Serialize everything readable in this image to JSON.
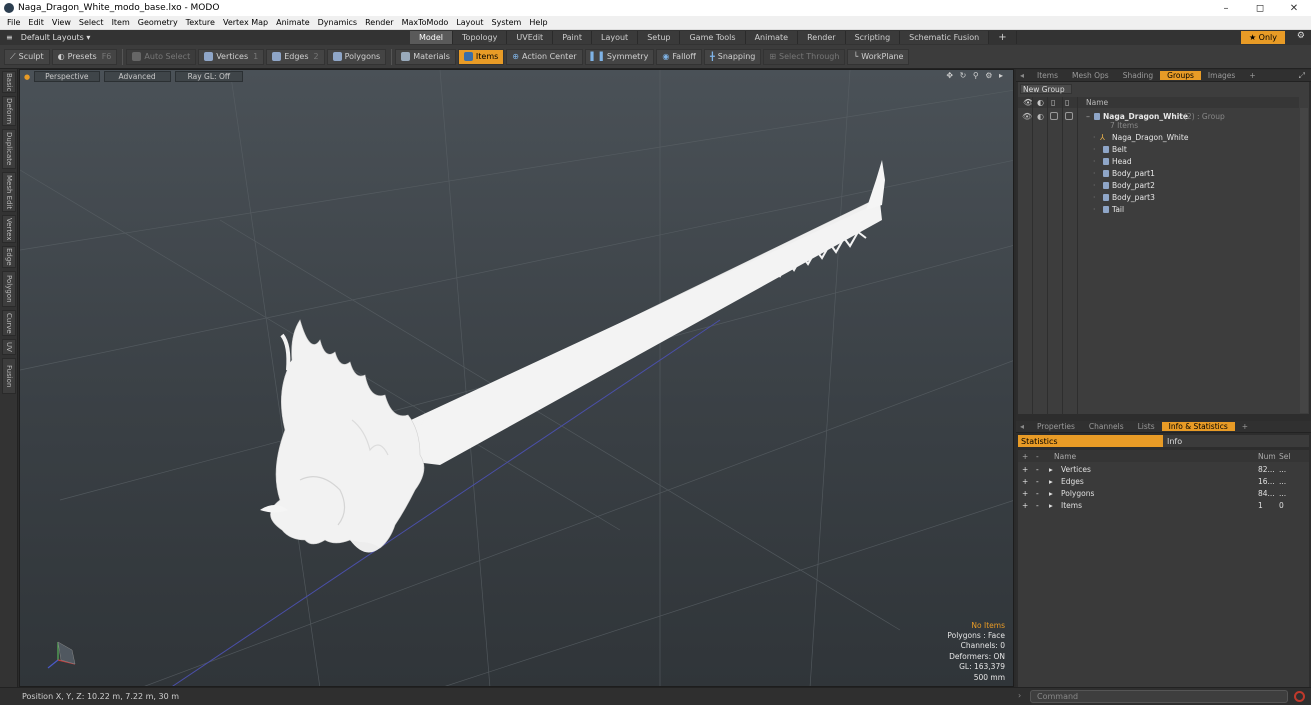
{
  "window": {
    "title": "Naga_Dragon_White_modo_base.lxo - MODO",
    "controls": [
      "–",
      "◻",
      "✕"
    ]
  },
  "menu": [
    "File",
    "Edit",
    "View",
    "Select",
    "Item",
    "Geometry",
    "Texture",
    "Vertex Map",
    "Animate",
    "Dynamics",
    "Render",
    "MaxToModo",
    "Layout",
    "System",
    "Help"
  ],
  "layout": {
    "selector": "Default Layouts ▾",
    "tabs": [
      "Model",
      "Topology",
      "UVEdit",
      "Paint",
      "Layout",
      "Setup",
      "Game Tools",
      "Animate",
      "Render",
      "Scripting",
      "Schematic Fusion",
      "+"
    ],
    "active_tab": "Model",
    "only_label": "★  Only"
  },
  "toolbar": {
    "sculpt": "Sculpt",
    "presets": "Presets",
    "presets_key": "F6",
    "auto_select": "Auto Select",
    "vertices": "Vertices",
    "vertices_key": "1",
    "edges": "Edges",
    "edges_key": "2",
    "polygons": "Polygons",
    "materials": "Materials",
    "items": "Items",
    "action_center": "Action Center",
    "symmetry": "Symmetry",
    "falloff": "Falloff",
    "snapping": "Snapping",
    "select_through": "Select Through",
    "workplane": "WorkPlane"
  },
  "left_tabs": [
    "Basic",
    "Deform",
    "Duplicate",
    "Mesh Edit",
    "Vertex",
    "Edge",
    "Polygon",
    "Curve",
    "UV",
    "Fusion"
  ],
  "viewport": {
    "view": "Perspective",
    "shading": "Advanced",
    "raygl": "Ray GL: Off",
    "icons": "✥ ↻ ⚲ ⚙ ▸",
    "info": {
      "no_items": "No Items",
      "polygons": "Polygons : Face",
      "channels": "Channels: 0",
      "deformers": "Deformers: ON",
      "gl": "GL: 163,379",
      "scale": "500 mm"
    }
  },
  "status": {
    "position": "Position X, Y, Z:  10.22 m, 7.22 m, 30 m",
    "command_placeholder": "Command"
  },
  "groups_panel": {
    "tabs": [
      "Items",
      "Mesh Ops",
      "Shading",
      "Groups",
      "Images",
      "+"
    ],
    "active_tab": "Groups",
    "new_group": "New Group",
    "name_header": "Name",
    "root": {
      "name": "Naga_Dragon_White",
      "suffix": " (2) : Group",
      "sub": "7 Items"
    },
    "items": [
      "Naga_Dragon_White",
      "Belt",
      "Head",
      "Body_part1",
      "Body_part2",
      "Body_part3",
      "Tail"
    ]
  },
  "info_panel": {
    "tabs": [
      "Properties",
      "Channels",
      "Lists",
      "Info & Statistics",
      "+"
    ],
    "active_tab": "Info & Statistics",
    "sub_tabs": [
      "Statistics",
      "Info"
    ],
    "headers": {
      "name": "Name",
      "num": "Num",
      "sel": "Sel"
    },
    "rows": [
      {
        "name": "Vertices",
        "num": "82...",
        "sel": "..."
      },
      {
        "name": "Edges",
        "num": "16...",
        "sel": "..."
      },
      {
        "name": "Polygons",
        "num": "84...",
        "sel": "..."
      },
      {
        "name": "Items",
        "num": "1",
        "sel": "0"
      }
    ]
  },
  "colors": {
    "accent": "#e89b26",
    "viewport_top": "#4a5157",
    "viewport_bottom": "#303539",
    "model": "#f2f2f2"
  }
}
